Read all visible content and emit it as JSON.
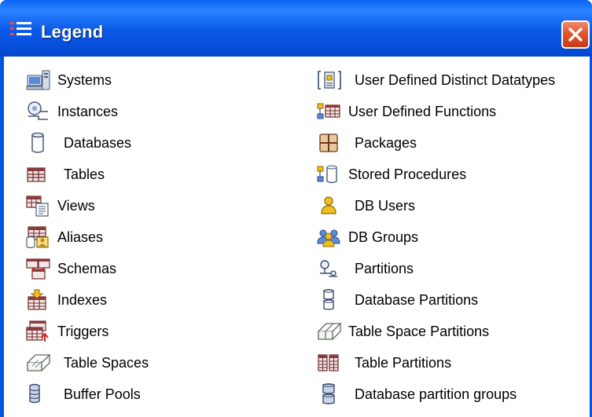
{
  "window": {
    "title": "Legend",
    "title_icon": "legend-list-icon",
    "close_icon": "close-icon"
  },
  "colors": {
    "titlebar": "#0a58e8",
    "close_button": "#e2552e",
    "client_background": "#ffffff"
  },
  "legend": {
    "left": [
      {
        "label": "Systems",
        "icon": "systems-icon"
      },
      {
        "label": "Instances",
        "icon": "instances-icon"
      },
      {
        "label": "Databases",
        "icon": "databases-icon"
      },
      {
        "label": "Tables",
        "icon": "tables-icon"
      },
      {
        "label": "Views",
        "icon": "views-icon"
      },
      {
        "label": "Aliases",
        "icon": "aliases-icon"
      },
      {
        "label": "Schemas",
        "icon": "schemas-icon"
      },
      {
        "label": "Indexes",
        "icon": "indexes-icon"
      },
      {
        "label": "Triggers",
        "icon": "triggers-icon"
      },
      {
        "label": "Table Spaces",
        "icon": "table-spaces-icon"
      },
      {
        "label": "Buffer Pools",
        "icon": "buffer-pools-icon"
      }
    ],
    "right": [
      {
        "label": "User Defined Distinct Datatypes",
        "icon": "user-defined-distinct-datatypes-icon"
      },
      {
        "label": "User Defined Functions",
        "icon": "user-defined-functions-icon"
      },
      {
        "label": "Packages",
        "icon": "packages-icon"
      },
      {
        "label": "Stored Procedures",
        "icon": "stored-procedures-icon"
      },
      {
        "label": "DB Users",
        "icon": "db-users-icon"
      },
      {
        "label": "DB Groups",
        "icon": "db-groups-icon"
      },
      {
        "label": "Partitions",
        "icon": "partitions-icon"
      },
      {
        "label": "Database Partitions",
        "icon": "database-partitions-icon"
      },
      {
        "label": "Table Space Partitions",
        "icon": "table-space-partitions-icon"
      },
      {
        "label": "Table Partitions",
        "icon": "table-partitions-icon"
      },
      {
        "label": "Database partition groups",
        "icon": "database-partition-groups-icon"
      }
    ]
  }
}
